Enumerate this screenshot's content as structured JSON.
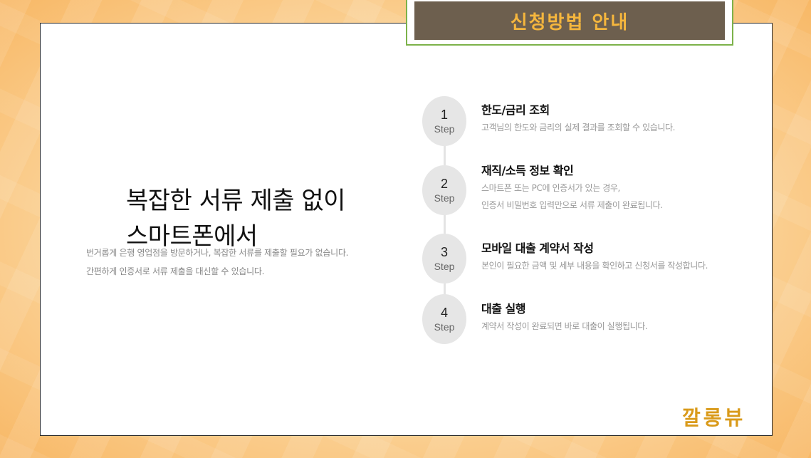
{
  "banner": {
    "title": "신청방법 안내"
  },
  "hero": {
    "headline_line1": "복잡한 서류 제출 없이",
    "headline_line2": "스마트폰에서",
    "desc_line1": "번거롭게 은행 영업점을 방문하거나, 복잡한 서류를 제출할 필요가 없습니다.",
    "desc_line2": "간편하게 인증서로 서류 제출을 대신할 수 있습니다."
  },
  "steps": [
    {
      "number": "1",
      "word": "Step",
      "title": "한도/금리 조회",
      "desc1": "고객님의 한도와 금리의 실제 결과를 조회할 수 있습니다.",
      "desc2": ""
    },
    {
      "number": "2",
      "word": "Step",
      "title": "재직/소득 정보 확인",
      "desc1": "스마트폰 또는 PC에 인증서가 있는 경우,",
      "desc2": "인증서 비밀번호 입력만으로 서류 제출이 완료됩니다."
    },
    {
      "number": "3",
      "word": "Step",
      "title": "모바일 대출 계약서 작성",
      "desc1": "본인이 필요한 금액 및 세부 내용을 확인하고 신청서를 작성합니다.",
      "desc2": ""
    },
    {
      "number": "4",
      "word": "Step",
      "title": "대출 실행",
      "desc1": "계약서 작성이 완료되면 바로 대출이 실행됩니다.",
      "desc2": ""
    }
  ],
  "watermark": {
    "text": "깔롱뷰"
  },
  "colors": {
    "banner_bg": "#6d5f4e",
    "banner_text": "#f5b63d",
    "banner_border": "#7cb24a",
    "watermark": "#d99a1a"
  }
}
